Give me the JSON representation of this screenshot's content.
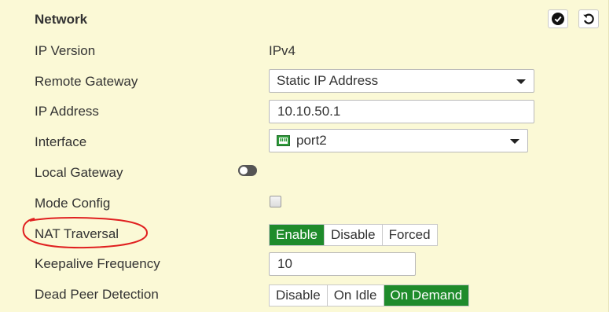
{
  "section": {
    "title": "Network",
    "apply_icon": "check-circle-icon",
    "revert_icon": "undo-icon"
  },
  "fields": {
    "ip_version": {
      "label": "IP Version",
      "value": "IPv4"
    },
    "remote_gateway": {
      "label": "Remote Gateway",
      "value": "Static IP Address"
    },
    "ip_address": {
      "label": "IP Address",
      "value": "10.10.50.1"
    },
    "interface": {
      "label": "Interface",
      "value": "port2",
      "icon": "network-port-icon"
    },
    "local_gateway": {
      "label": "Local Gateway",
      "enabled": false
    },
    "mode_config": {
      "label": "Mode Config",
      "checked": false
    },
    "nat_traversal": {
      "label": "NAT Traversal",
      "options": [
        "Enable",
        "Disable",
        "Forced"
      ],
      "selected": "Enable"
    },
    "keepalive": {
      "label": "Keepalive Frequency",
      "value": "10"
    },
    "dpd": {
      "label": "Dead Peer Detection",
      "options": [
        "Disable",
        "On Idle",
        "On Demand"
      ],
      "selected": "On Demand"
    }
  },
  "colors": {
    "panel_bg": "#fbf9d6",
    "active_green": "#1e8b2b",
    "annotation_red": "#e02020"
  }
}
